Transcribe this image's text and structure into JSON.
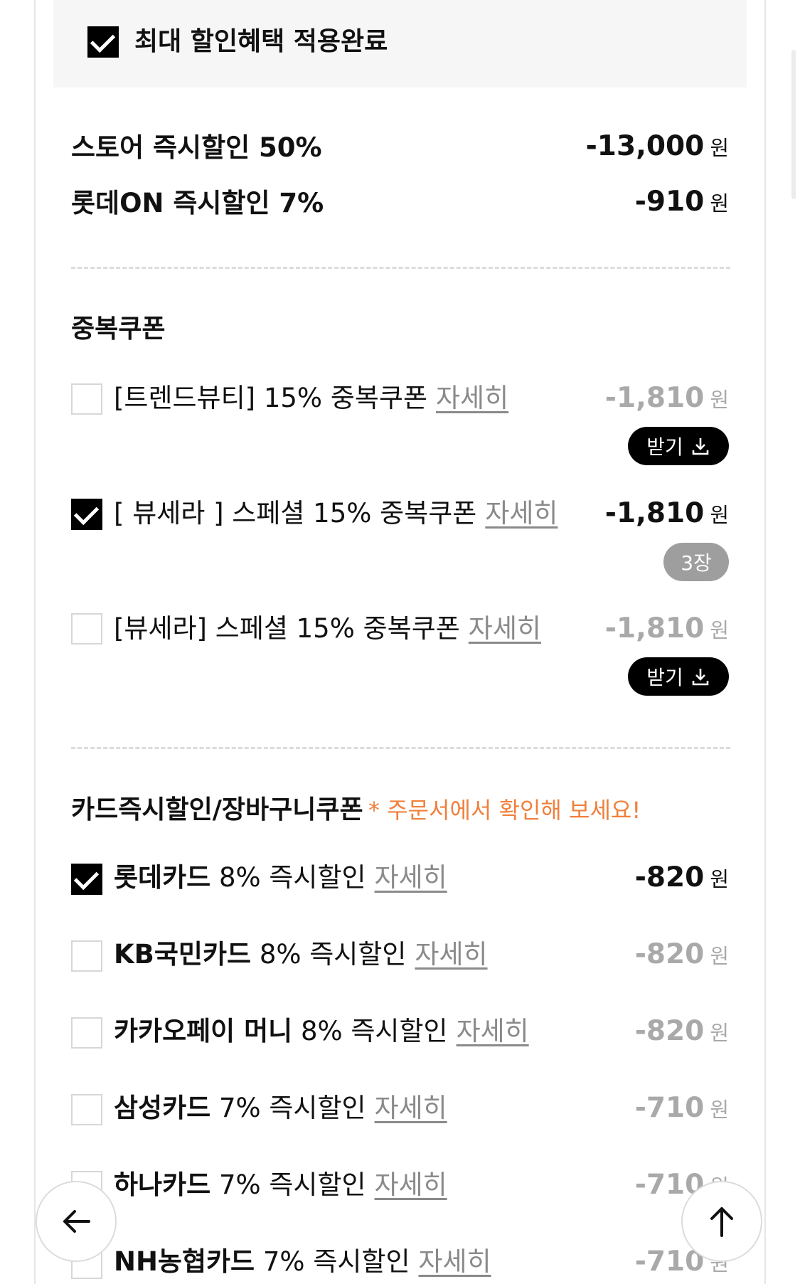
{
  "banner": {
    "label": "최대 할인혜택 적용완료",
    "checked": true
  },
  "instant_discounts": [
    {
      "label": "스토어 즉시할인 50%",
      "amount": "-13,000",
      "unit": "원"
    },
    {
      "label": "롯데ON 즉시할인 7%",
      "amount": "-910",
      "unit": "원"
    }
  ],
  "coupon_section": {
    "title": "중복쿠폰",
    "items": [
      {
        "label": "[트렌드뷰티] 15% 중복쿠폰",
        "detail": "자세히",
        "amount": "-1,810",
        "unit": "원",
        "checked": false,
        "action": "받기"
      },
      {
        "label": "[ 뷰세라 ] 스페셜 15% 중복쿠폰",
        "detail": "자세히",
        "amount": "-1,810",
        "unit": "원",
        "checked": true,
        "count": "3장"
      },
      {
        "label": "[뷰세라] 스페셜 15% 중복쿠폰",
        "detail": "자세히",
        "amount": "-1,810",
        "unit": "원",
        "checked": false,
        "action": "받기"
      }
    ]
  },
  "card_section": {
    "title": "카드즉시할인/장바구니쿠폰",
    "note": "* 주문서에서 확인해 보세요!",
    "items": [
      {
        "card": "롯데카드",
        "rate": "8% 즉시할인",
        "detail": "자세히",
        "amount": "-820",
        "unit": "원",
        "checked": true
      },
      {
        "card": "KB국민카드",
        "rate": "8% 즉시할인",
        "detail": "자세히",
        "amount": "-820",
        "unit": "원",
        "checked": false
      },
      {
        "card": "카카오페이 머니",
        "rate": "8% 즉시할인",
        "detail": "자세히",
        "amount": "-820",
        "unit": "원",
        "checked": false
      },
      {
        "card": "삼성카드",
        "rate": "7% 즉시할인",
        "detail": "자세히",
        "amount": "-710",
        "unit": "원",
        "checked": false
      },
      {
        "card": "하나카드",
        "rate": "7% 즉시할인",
        "detail": "자세히",
        "amount": "-710",
        "unit": "원",
        "checked": false
      },
      {
        "card": "NH농협카드",
        "rate": "7% 즉시할인",
        "detail": "자세히",
        "amount": "-710",
        "unit": "원",
        "checked": false
      }
    ]
  },
  "icons": {
    "back": "arrow-left-icon",
    "top": "arrow-up-icon",
    "download": "download-icon"
  },
  "colors": {
    "accent_note": "#f0803c",
    "muted": "#a9a9a9",
    "checked": "#000000"
  }
}
